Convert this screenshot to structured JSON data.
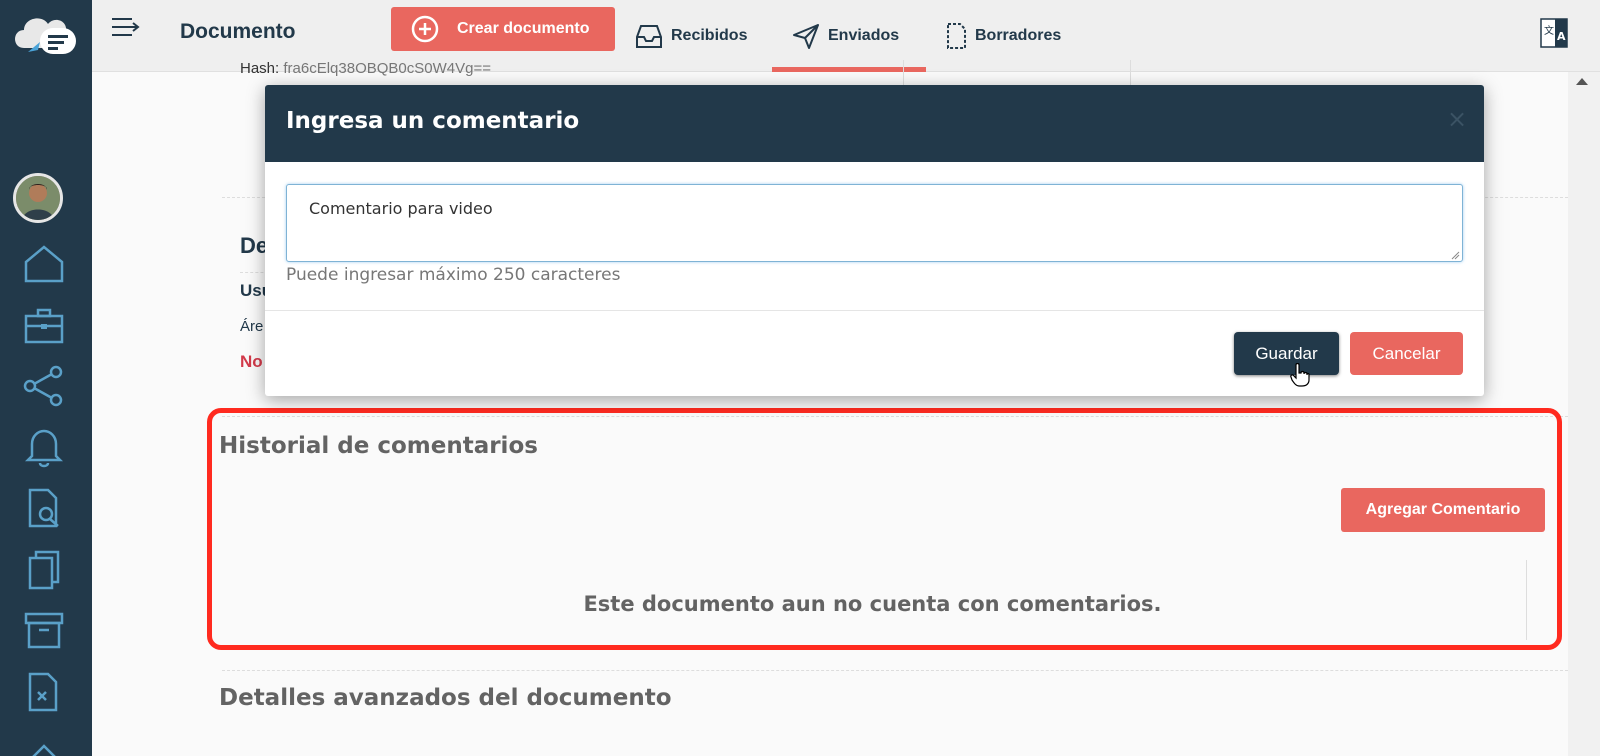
{
  "header": {
    "title": "Documento",
    "create_label": "Crear documento",
    "tabs": [
      {
        "label": "Recibidos",
        "icon": "inbox-icon"
      },
      {
        "label": "Enviados",
        "icon": "send-icon",
        "active": true
      },
      {
        "label": "Borradores",
        "icon": "draft-icon"
      }
    ]
  },
  "sidebar": {
    "items": [
      "home-icon",
      "briefcase-icon",
      "share-icon",
      "bell-icon",
      "document-search-icon",
      "copy-icon",
      "archive-icon",
      "document-x-icon"
    ]
  },
  "background": {
    "hash_label": "Hash:",
    "hash_value": "fra6cElq38OBQB0cS0W4Vg==",
    "partial_heading": "De",
    "partial_user": "Usu",
    "partial_area": "Áre",
    "partial_red": "No",
    "comments_section_title": "Historial de comentarios",
    "add_comment_label": "Agregar Comentario",
    "empty_message": "Este documento aun no cuenta con comentarios.",
    "advanced_title": "Detalles avanzados del documento"
  },
  "modal": {
    "title": "Ingresa un comentario",
    "close_symbol": "×",
    "comment_value": "Comentario para video",
    "help_text": "Puede ingresar máximo 250 caracteres",
    "save_label": "Guardar",
    "cancel_label": "Cancelar"
  },
  "colors": {
    "sidebar": "#22394a",
    "accent": "#e9675f",
    "highlight": "#ff2a1f"
  }
}
